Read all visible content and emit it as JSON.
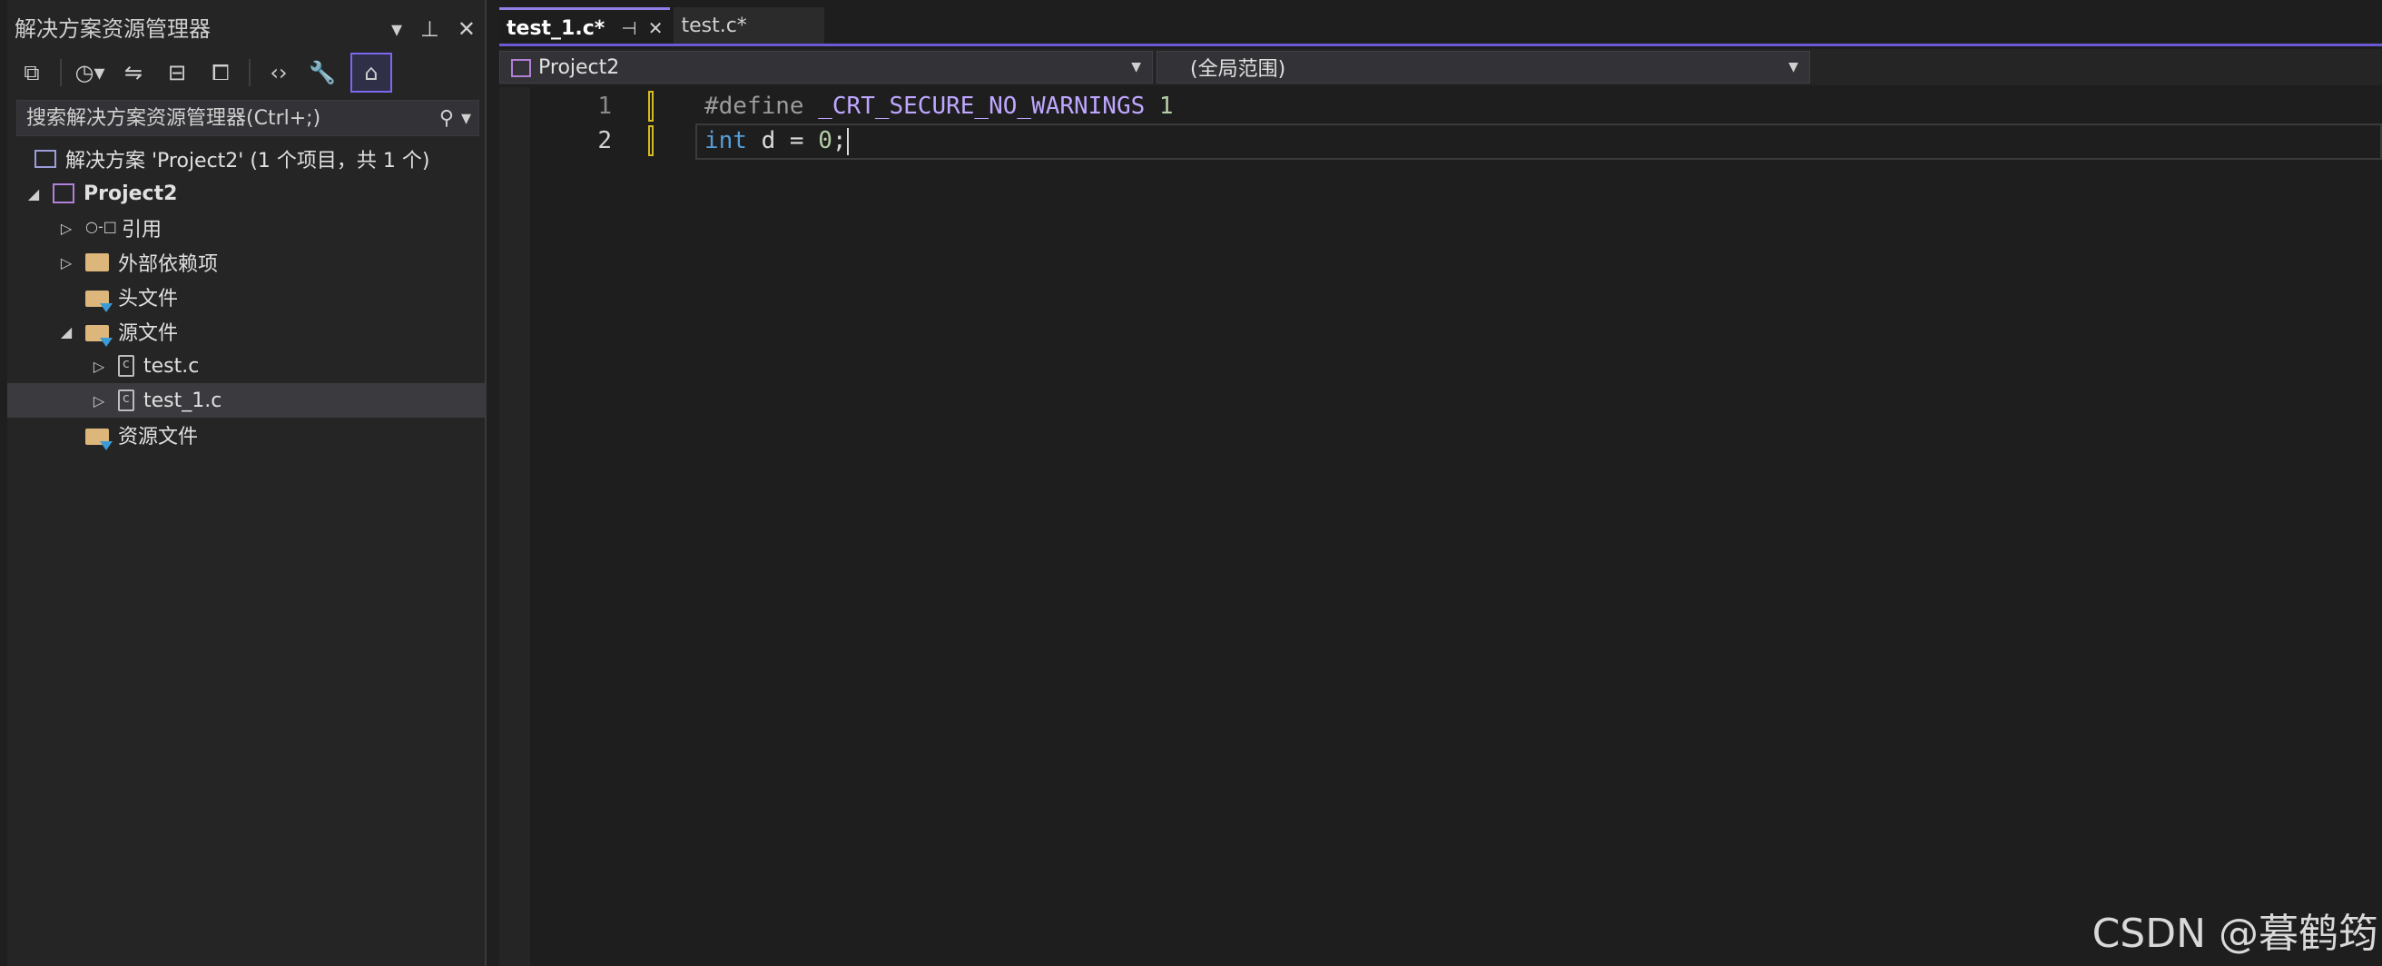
{
  "solution_explorer": {
    "title": "解决方案资源管理器",
    "search_placeholder": "搜索解决方案资源管理器(Ctrl+;)",
    "tree": [
      {
        "id": "solution",
        "label": "解决方案 'Project2' (1 个项目，共 1 个)",
        "icon": "solution-icon"
      },
      {
        "id": "project",
        "label": "Project2",
        "icon": "project-icon"
      },
      {
        "id": "references",
        "label": "引用",
        "icon": "references-icon"
      },
      {
        "id": "external-deps",
        "label": "外部依赖项",
        "icon": "external-dependencies-icon"
      },
      {
        "id": "headers",
        "label": "头文件",
        "icon": "filter-folder-icon"
      },
      {
        "id": "sources",
        "label": "源文件",
        "icon": "filter-folder-icon"
      },
      {
        "id": "test-c",
        "label": "test.c",
        "icon": "c-file-icon"
      },
      {
        "id": "test1-c",
        "label": "test_1.c",
        "icon": "c-file-icon",
        "selected": true
      },
      {
        "id": "resources",
        "label": "资源文件",
        "icon": "filter-folder-icon"
      }
    ]
  },
  "editor": {
    "tabs": [
      {
        "label": "test_1.c*",
        "active": true
      },
      {
        "label": "test.c*",
        "active": false
      }
    ],
    "nav": {
      "project": "Project2",
      "scope": "(全局范围)"
    },
    "lines": [
      {
        "number": "1",
        "tokens": {
          "directive": "#define",
          "macro": "_CRT_SECURE_NO_WARNINGS",
          "value": "1"
        }
      },
      {
        "number": "2",
        "tokens": {
          "type": "int",
          "rest_a": " d = ",
          "value": "0",
          "rest_b": ";"
        }
      }
    ]
  },
  "watermark": "CSDN @暮鹤筠",
  "colors": {
    "accent": "#6b5ad6",
    "keyword": "#569cd6",
    "macro": "#bfa6ff",
    "number": "#b5cea8",
    "change_marker": "#d7ba21"
  }
}
